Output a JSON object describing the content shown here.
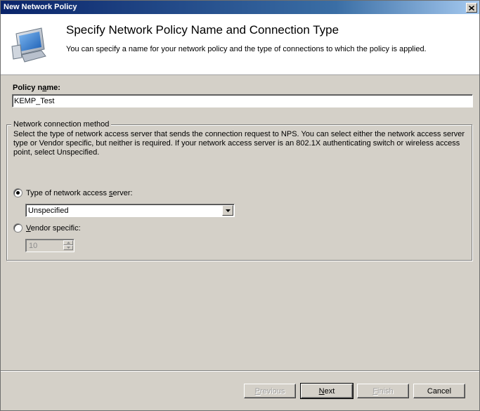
{
  "window": {
    "title": "New Network Policy"
  },
  "header": {
    "title": "Specify Network Policy Name and Connection Type",
    "subtitle": "You can specify a name for your network policy and the type of connections to which the policy is applied."
  },
  "policy": {
    "label_pre": "Policy n",
    "label_mn": "a",
    "label_post": "me:",
    "value": "KEMP_Test"
  },
  "connection": {
    "legend": "Network connection method",
    "description": "Select the type of network access server that sends the connection request to NPS. You can select either the network access server type or Vendor specific, but neither is required.  If your network access server is an 802.1X authenticating switch or wireless access point, select Unspecified.",
    "type_radio": {
      "label_pre": "Type of network access ",
      "label_mn": "s",
      "label_post": "erver:",
      "selected": true
    },
    "type_select": {
      "value": "Unspecified"
    },
    "vendor_radio": {
      "label_pre": "",
      "label_mn": "V",
      "label_post": "endor specific:",
      "selected": false
    },
    "vendor_spinner": {
      "value": "10"
    }
  },
  "buttons": {
    "previous": {
      "pre": "",
      "mn": "P",
      "post": "revious"
    },
    "next": {
      "pre": "",
      "mn": "N",
      "post": "ext"
    },
    "finish": {
      "pre": "",
      "mn": "F",
      "post": "inish"
    },
    "cancel": {
      "label": "Cancel"
    }
  },
  "icons": {
    "close": "close-icon",
    "header": "network-computer-icon",
    "dropdown": "chevron-down-icon"
  }
}
